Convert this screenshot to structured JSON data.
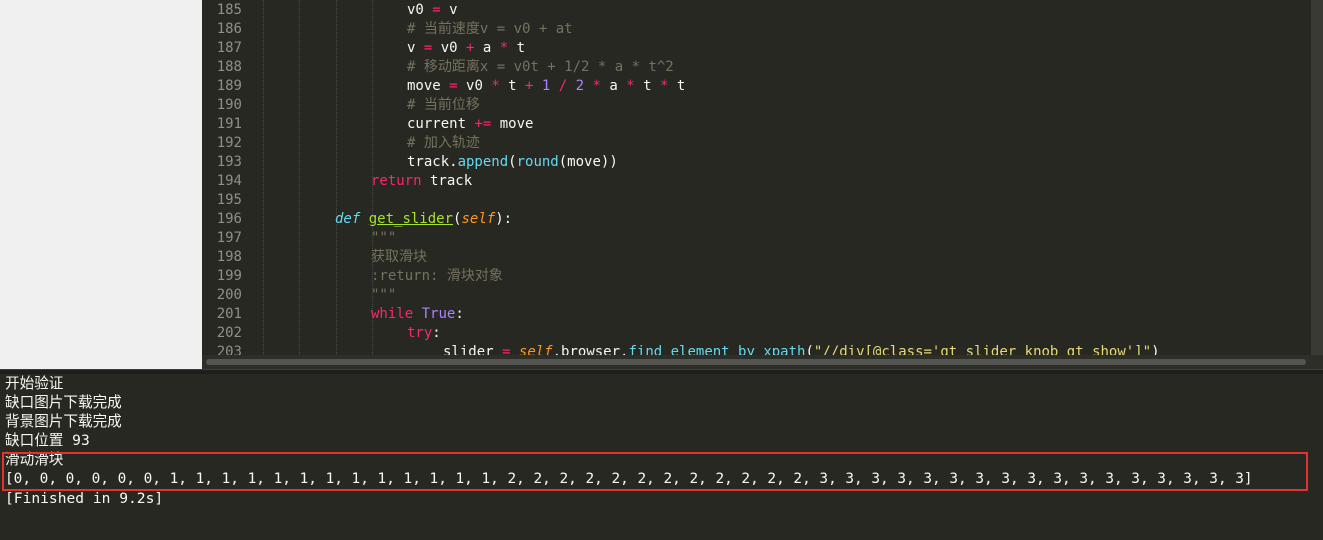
{
  "editor": {
    "lines": [
      {
        "num": "185",
        "tokens": [
          {
            "t": "v0 ",
            "c": ""
          },
          {
            "t": "=",
            "c": "op"
          },
          {
            "t": " v",
            "c": ""
          }
        ],
        "indent": 4
      },
      {
        "num": "186",
        "tokens": [
          {
            "t": "# 当前速度v = v0 + at",
            "c": "cm"
          }
        ],
        "indent": 4
      },
      {
        "num": "187",
        "tokens": [
          {
            "t": "v ",
            "c": ""
          },
          {
            "t": "=",
            "c": "op"
          },
          {
            "t": " v0 ",
            "c": ""
          },
          {
            "t": "+",
            "c": "op"
          },
          {
            "t": " a ",
            "c": ""
          },
          {
            "t": "*",
            "c": "op"
          },
          {
            "t": " t",
            "c": ""
          }
        ],
        "indent": 4
      },
      {
        "num": "188",
        "tokens": [
          {
            "t": "# 移动距离x = v0t + 1/2 * a * t^2",
            "c": "cm"
          }
        ],
        "indent": 4
      },
      {
        "num": "189",
        "tokens": [
          {
            "t": "move ",
            "c": ""
          },
          {
            "t": "=",
            "c": "op"
          },
          {
            "t": " v0 ",
            "c": ""
          },
          {
            "t": "*",
            "c": "op"
          },
          {
            "t": " t ",
            "c": ""
          },
          {
            "t": "+",
            "c": "op"
          },
          {
            "t": " ",
            "c": ""
          },
          {
            "t": "1",
            "c": "num"
          },
          {
            "t": " ",
            "c": ""
          },
          {
            "t": "/",
            "c": "op"
          },
          {
            "t": " ",
            "c": ""
          },
          {
            "t": "2",
            "c": "num"
          },
          {
            "t": " ",
            "c": ""
          },
          {
            "t": "*",
            "c": "op"
          },
          {
            "t": " a ",
            "c": ""
          },
          {
            "t": "*",
            "c": "op"
          },
          {
            "t": " t ",
            "c": ""
          },
          {
            "t": "*",
            "c": "op"
          },
          {
            "t": " t",
            "c": ""
          }
        ],
        "indent": 4
      },
      {
        "num": "190",
        "tokens": [
          {
            "t": "# 当前位移",
            "c": "cm"
          }
        ],
        "indent": 4
      },
      {
        "num": "191",
        "tokens": [
          {
            "t": "current ",
            "c": ""
          },
          {
            "t": "+=",
            "c": "op"
          },
          {
            "t": " move",
            "c": ""
          }
        ],
        "indent": 4
      },
      {
        "num": "192",
        "tokens": [
          {
            "t": "# 加入轨迹",
            "c": "cm"
          }
        ],
        "indent": 4
      },
      {
        "num": "193",
        "tokens": [
          {
            "t": "track.",
            "c": ""
          },
          {
            "t": "append",
            "c": "bi"
          },
          {
            "t": "(",
            "c": ""
          },
          {
            "t": "round",
            "c": "bi"
          },
          {
            "t": "(move))",
            "c": ""
          }
        ],
        "indent": 4
      },
      {
        "num": "194",
        "tokens": [
          {
            "t": "return",
            "c": "kw"
          },
          {
            "t": " track",
            "c": ""
          }
        ],
        "indent": 3
      },
      {
        "num": "195",
        "tokens": [],
        "indent": 0
      },
      {
        "num": "196",
        "tokens": [
          {
            "t": "def",
            "c": "def"
          },
          {
            "t": " ",
            "c": ""
          },
          {
            "t": "get_slider",
            "c": "fn"
          },
          {
            "t": "(",
            "c": ""
          },
          {
            "t": "self",
            "c": "self"
          },
          {
            "t": "):",
            "c": ""
          }
        ],
        "indent": 2
      },
      {
        "num": "197",
        "tokens": [
          {
            "t": "\"\"\"",
            "c": "cm"
          }
        ],
        "indent": 3
      },
      {
        "num": "198",
        "tokens": [
          {
            "t": "获取滑块",
            "c": "cm"
          }
        ],
        "indent": 3
      },
      {
        "num": "199",
        "tokens": [
          {
            "t": ":return: 滑块对象",
            "c": "cm"
          }
        ],
        "indent": 3
      },
      {
        "num": "200",
        "tokens": [
          {
            "t": "\"\"\"",
            "c": "cm"
          }
        ],
        "indent": 3
      },
      {
        "num": "201",
        "tokens": [
          {
            "t": "while",
            "c": "kw"
          },
          {
            "t": " ",
            "c": ""
          },
          {
            "t": "True",
            "c": "const"
          },
          {
            "t": ":",
            "c": ""
          }
        ],
        "indent": 3
      },
      {
        "num": "202",
        "tokens": [
          {
            "t": "try",
            "c": "kw"
          },
          {
            "t": ":",
            "c": ""
          }
        ],
        "indent": 4
      },
      {
        "num": "203",
        "tokens": [
          {
            "t": "slider ",
            "c": ""
          },
          {
            "t": "=",
            "c": "op"
          },
          {
            "t": " ",
            "c": ""
          },
          {
            "t": "self",
            "c": "self"
          },
          {
            "t": ".browser.",
            "c": ""
          },
          {
            "t": "find_element_by_xpath",
            "c": "bi"
          },
          {
            "t": "(",
            "c": ""
          },
          {
            "t": "\"//div[@class='gt_slider_knob gt_show']\"",
            "c": "str"
          },
          {
            "t": ")",
            "c": ""
          }
        ],
        "indent": 5
      }
    ]
  },
  "console": {
    "lines": [
      "开始验证",
      "缺口图片下载完成",
      "背景图片下载完成",
      "缺口位置 93",
      "滑动滑块",
      "[0, 0, 0, 0, 0, 0, 1, 1, 1, 1, 1, 1, 1, 1, 1, 1, 1, 1, 1, 2, 2, 2, 2, 2, 2, 2, 2, 2, 2, 2, 2, 3, 3, 3, 3, 3, 3, 3, 3, 3, 3, 3, 3, 3, 3, 3, 3, 3]",
      "[Finished in 9.2s]"
    ]
  },
  "colors": {
    "background": "#272822",
    "highlight_border": "#e8312f"
  }
}
